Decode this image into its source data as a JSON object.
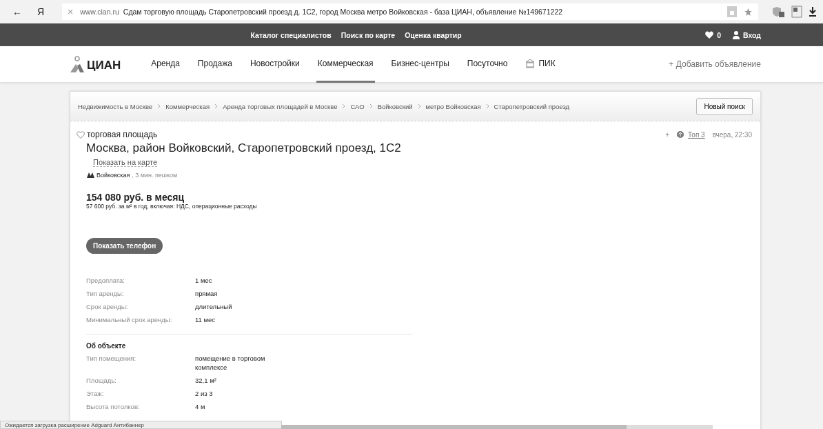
{
  "browser": {
    "back": "←",
    "logo": "Я",
    "close": "×",
    "domain": "www.cian.ru",
    "page_title": "Сдам торговую площадь Старопетровский проезд д. 1С2, город Москва метро Войковская - база ЦИАН, объявление №149671222"
  },
  "topbar": {
    "links": [
      "Каталог специалистов",
      "Поиск по карте",
      "Оценка квартир"
    ],
    "favorites_count": "0",
    "login": "Вход"
  },
  "header": {
    "logo": "ЦИАН",
    "nav": [
      {
        "label": "Аренда",
        "selected": false
      },
      {
        "label": "Продажа",
        "selected": false
      },
      {
        "label": "Новостройки",
        "selected": false
      },
      {
        "label": "Коммерческая",
        "selected": true
      },
      {
        "label": "Бизнес-центры",
        "selected": false
      },
      {
        "label": "Посуточно",
        "selected": false
      },
      {
        "label": "ПИК",
        "selected": false,
        "kind": "brand"
      }
    ],
    "add_listing": "+ Добавить объявление"
  },
  "breadcrumbs": [
    "Недвижимость в Москве",
    "Коммерческая",
    "Аренда торговых площадей в Москве",
    "САО",
    "Войковский",
    "метро Войковская",
    "Старопетровский проезд"
  ],
  "new_search": "Новый поиск",
  "listing": {
    "type": "торговая площадь",
    "plus": "+",
    "top": "Топ 3",
    "date": "вчера, 22:30",
    "address": "Москва, район Войковский, Старопетровский проезд, 1С2",
    "map_link": "Показать на карте",
    "metro": "Войковская",
    "walk": ", 3 мин. пешком",
    "price": "154 080 руб. в месяц",
    "price_note": "57 600 руб. за м² в год, включая: НДС, операционные расходы",
    "phone_button": "Показать телефон"
  },
  "terms": [
    {
      "label": "Предоплата:",
      "value": "1 мес"
    },
    {
      "label": "Тип аренды:",
      "value": "прямая"
    },
    {
      "label": "Срок аренды:",
      "value": "длительный"
    },
    {
      "label": "Минимальный срок аренды:",
      "value": "11 мес"
    }
  ],
  "object": {
    "title": "Об объекте",
    "rows": [
      {
        "label": "Тип помещения:",
        "value": "помещение в торговом комплексе"
      },
      {
        "label": "Площадь:",
        "value": "32,1 м²"
      },
      {
        "label": "Этаж:",
        "value": "2 из 3"
      },
      {
        "label": "Высота потолков:",
        "value": "4 м"
      }
    ]
  },
  "status_bar": "Ожидается загрузка расширение Adguard Антибаннер"
}
